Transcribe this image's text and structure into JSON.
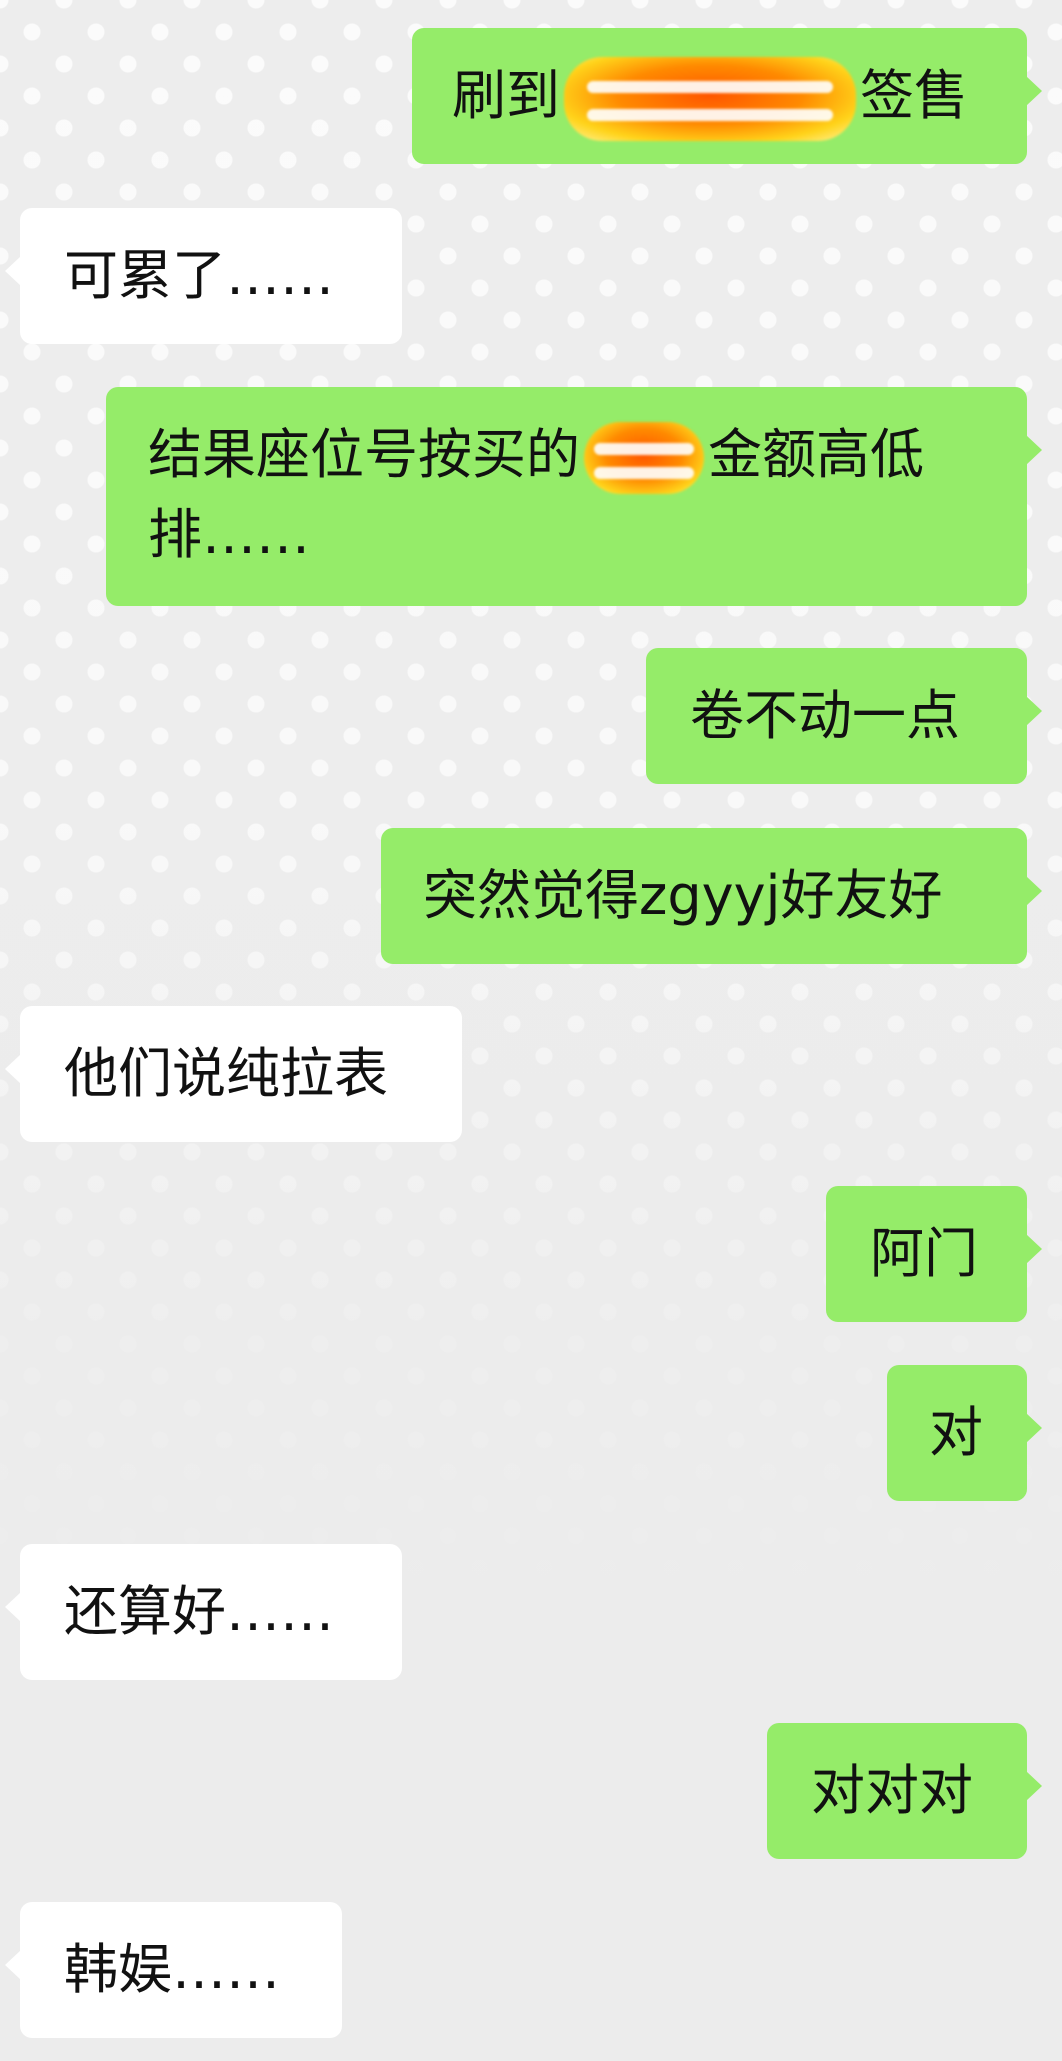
{
  "chat": {
    "colors": {
      "outgoing_bubble": "#95ec69",
      "incoming_bubble": "#ffffff",
      "background": "#ededed",
      "text": "#111111"
    },
    "messages": [
      {
        "side": "outgoing",
        "before": "刷到",
        "sticker": "blurred-emoji-sticker",
        "after": "签售"
      },
      {
        "side": "incoming",
        "text": "可累了……"
      },
      {
        "side": "outgoing",
        "line1_before": "结果座位号按买的",
        "sticker": "blurred-emoji-sticker",
        "line1_after": "金额高低",
        "line2": "排……"
      },
      {
        "side": "outgoing",
        "text": "卷不动一点"
      },
      {
        "side": "outgoing",
        "text": "突然觉得zgyyj好友好"
      },
      {
        "side": "incoming",
        "text": "他们说纯拉表"
      },
      {
        "side": "outgoing",
        "text": "阿门"
      },
      {
        "side": "outgoing",
        "text": "对"
      },
      {
        "side": "incoming",
        "text": "还算好……"
      },
      {
        "side": "outgoing",
        "text": "对对对"
      },
      {
        "side": "incoming",
        "text": "韩娱……"
      }
    ]
  }
}
